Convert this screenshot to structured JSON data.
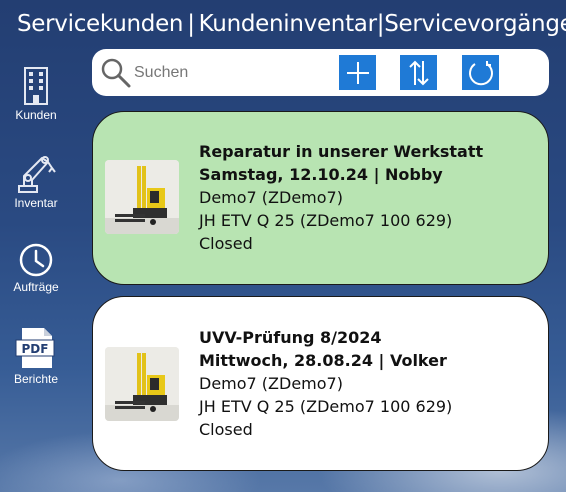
{
  "header": {
    "tab1": "Servicekunden",
    "tab2": "Kundeninventar",
    "tab3": "Servicevorgänge",
    "sep1": "|",
    "sep2": "|"
  },
  "sidebar": {
    "items": [
      {
        "label": "Kunden",
        "icon": "building-icon"
      },
      {
        "label": "Inventar",
        "icon": "robot-arm-icon"
      },
      {
        "label": "Aufträge",
        "icon": "clock-icon"
      },
      {
        "label": "Berichte",
        "icon": "pdf-icon"
      }
    ]
  },
  "search": {
    "placeholder": "Suchen",
    "value": ""
  },
  "toolbar": {
    "add": "plus-icon",
    "sort": "sort-arrows-icon",
    "refresh": "refresh-icon"
  },
  "cards": [
    {
      "title": "Reparatur in unserer Werkstatt",
      "date_line": "Samstag, 12.10.24 | Nobby",
      "customer": "Demo7 (ZDemo7)",
      "device": "JH ETV Q 25 (ZDemo7 100 629)",
      "status": "Closed",
      "background": "#b8e4b2"
    },
    {
      "title": "UVV-Prüfung 8/2024",
      "date_line": "Mittwoch, 28.08.24 | Volker",
      "customer": "Demo7 (ZDemo7)",
      "device": "JH ETV Q 25 (ZDemo7 100 629)",
      "status": "Closed",
      "background": "#ffffff"
    }
  ],
  "colors": {
    "accent": "#1f7ad6",
    "nav_icon": "#e4e8f2"
  }
}
